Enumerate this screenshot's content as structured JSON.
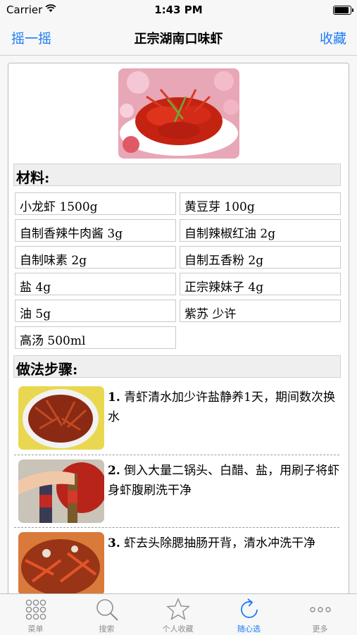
{
  "status": {
    "carrier": "Carrier",
    "time": "1:43 PM",
    "battery_level": 1.0
  },
  "navbar": {
    "left": "摇一摇",
    "title": "正宗湖南口味虾",
    "right": "收藏"
  },
  "ingredients": {
    "heading": "材料:",
    "items": [
      "小龙虾 1500g",
      "黄豆芽 100g",
      "自制香辣牛肉酱 3g",
      "自制辣椒红油 2g",
      "自制味素 2g",
      "自制五香粉 2g",
      "盐 4g",
      "正宗辣妹子 4g",
      "油 5g",
      "紫苏 少许",
      "高汤 500ml"
    ]
  },
  "steps": {
    "heading": "做法步骤:",
    "items": [
      {
        "num": "1.",
        "text": "青虾清水加少许盐静养1天，期间数次换水"
      },
      {
        "num": "2.",
        "text": "倒入大量二锅头、白醋、盐，用刷子将虾身虾腹刷洗干净"
      },
      {
        "num": "3.",
        "text": "虾去头除腮抽肠开背，清水冲洗干净"
      }
    ]
  },
  "tabbar": {
    "tabs": [
      {
        "label": "菜单",
        "icon": "grid-icon"
      },
      {
        "label": "搜索",
        "icon": "search-icon"
      },
      {
        "label": "个人收藏",
        "icon": "star-icon"
      },
      {
        "label": "随心选",
        "icon": "refresh-icon"
      },
      {
        "label": "更多",
        "icon": "more-icon"
      }
    ],
    "active_index": 3
  },
  "colors": {
    "accent": "#1b7cf5",
    "inactive": "#8e8e8e"
  }
}
